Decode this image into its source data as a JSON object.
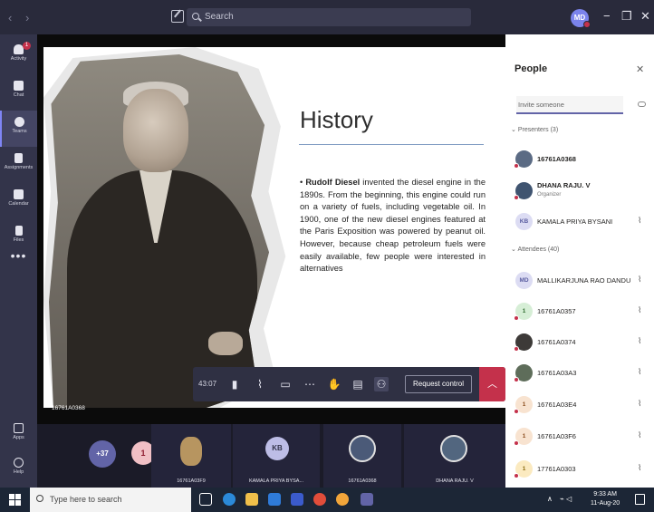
{
  "window": {
    "search_placeholder": "Search",
    "user_initials": "MD",
    "controls": {
      "minimize": "−",
      "maximize": "❐",
      "close": "✕"
    },
    "back": "‹",
    "forward": "›"
  },
  "rail": {
    "items": [
      {
        "label": "Activity",
        "badge": "1"
      },
      {
        "label": "Chat"
      },
      {
        "label": "Teams"
      },
      {
        "label": "Assignments"
      },
      {
        "label": "Calendar"
      },
      {
        "label": "Files"
      }
    ],
    "more": "•••",
    "apps": "Apps",
    "help": "Help"
  },
  "slide": {
    "title": "History",
    "bullet": "•",
    "body_bold": "Rudolf Diesel",
    "body_rest": " invented the diesel engine in the 1890s. From the beginning, this engine could run on a variety of fuels, including vegetable oil. In 1900, one of the new diesel engines featured at the Paris Exposition was powered by peanut oil. However, because cheap petroleum fuels were easily available, few people were interested in alternatives",
    "presenter": "16761A0368"
  },
  "toolbar": {
    "timer": "43:07",
    "request_control": "Request control"
  },
  "strip": {
    "overflow_count": "+37",
    "tiles": [
      {
        "initials": "1"
      },
      {
        "label": "16761A03F9"
      },
      {
        "initials": "KB",
        "label": "KAMALA PRIYA BYSA..."
      },
      {
        "label": "16761A0368"
      },
      {
        "label": "DHANA RAJU. V"
      }
    ]
  },
  "people": {
    "title": "People",
    "invite_placeholder": "Invite someone",
    "presenters_label": "Presenters (3)",
    "attendees_label": "Attendees (40)",
    "presenters": [
      {
        "name": "16761A0368",
        "initials": ""
      },
      {
        "name": "DHANA RAJU. V",
        "role": "Organizer",
        "initials": ""
      },
      {
        "name": "KAMALA PRIYA BYSANI",
        "initials": "KB"
      }
    ],
    "attendees": [
      {
        "name": "MALLIKARJUNA RAO DANDU",
        "initials": "MD"
      },
      {
        "name": "16761A0357",
        "initials": "1"
      },
      {
        "name": "16761A0374",
        "initials": ""
      },
      {
        "name": "16761A03A3",
        "initials": ""
      },
      {
        "name": "16761A03E4",
        "initials": "1"
      },
      {
        "name": "16761A03F6",
        "initials": "1"
      },
      {
        "name": "17761A0303",
        "initials": "1"
      }
    ]
  },
  "taskbar": {
    "search_placeholder": "Type here to search",
    "time": "9:33 AM",
    "date": "11-Aug-20"
  }
}
